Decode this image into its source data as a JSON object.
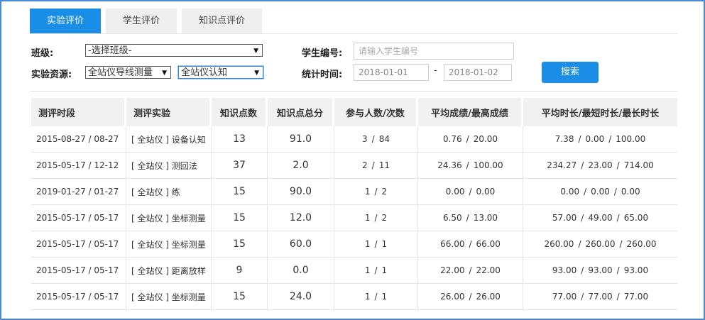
{
  "tabs": [
    {
      "label": "实验评价",
      "active": true
    },
    {
      "label": "学生评价",
      "active": false
    },
    {
      "label": "知识点评价",
      "active": false
    }
  ],
  "filters": {
    "class_label": "班级:",
    "class_value": "-选择班级-",
    "resource_label": "实验资源:",
    "resource_value_1": "全站仪导线测量",
    "resource_value_2": "全站仪认知",
    "student_label": "学生编号:",
    "student_placeholder": "请输入学生编号",
    "time_label": "统计时间:",
    "date_from": "2018-01-01",
    "date_to": "2018-01-02",
    "date_separator": "-",
    "search_label": "搜索"
  },
  "table": {
    "headers": [
      "测评时段",
      "测评实验",
      "知识点数",
      "知识点总分",
      "参与人数/次数",
      "平均成绩/最高成绩",
      "平均时长/最短时长/最长时长"
    ],
    "rows": [
      {
        "period": "2015-08-27 / 08-27",
        "experiment": "[ 全站仪 ] 设备认知",
        "kp_count": "13",
        "kp_total": "91.0",
        "participants": "3",
        "attempts": "84",
        "avg_score": "0.76",
        "max_score": "20.00",
        "avg_time": "7.38",
        "min_time": "0.00",
        "max_time": "100.00"
      },
      {
        "period": "2015-05-17 / 12-12",
        "experiment": "[ 全站仪 ] 测回法",
        "kp_count": "37",
        "kp_total": "2.0",
        "participants": "2",
        "attempts": "11",
        "avg_score": "24.36",
        "max_score": "100.00",
        "avg_time": "234.27",
        "min_time": "23.00",
        "max_time": "714.00"
      },
      {
        "period": "2019-01-27 / 01-27",
        "experiment": "[ 全站仪 ] 练",
        "kp_count": "15",
        "kp_total": "90.0",
        "participants": "1",
        "attempts": "2",
        "avg_score": "0.00",
        "max_score": "0.00",
        "avg_time": "0.00",
        "min_time": "0.00",
        "max_time": "0.00"
      },
      {
        "period": "2015-05-17 / 05-17",
        "experiment": "[ 全站仪 ] 坐标测量",
        "kp_count": "15",
        "kp_total": "12.0",
        "participants": "1",
        "attempts": "2",
        "avg_score": "6.50",
        "max_score": "13.00",
        "avg_time": "57.00",
        "min_time": "49.00",
        "max_time": "65.00"
      },
      {
        "period": "2015-05-17 / 05-17",
        "experiment": "[ 全站仪 ] 坐标测量",
        "kp_count": "15",
        "kp_total": "60.0",
        "participants": "1",
        "attempts": "1",
        "avg_score": "66.00",
        "max_score": "66.00",
        "avg_time": "260.00",
        "min_time": "260.00",
        "max_time": "260.00"
      },
      {
        "period": "2015-05-17 / 05-17",
        "experiment": "[ 全站仪 ] 距离放样",
        "kp_count": "9",
        "kp_total": "0.0",
        "participants": "1",
        "attempts": "1",
        "avg_score": "22.00",
        "max_score": "22.00",
        "avg_time": "93.00",
        "min_time": "93.00",
        "max_time": "93.00"
      },
      {
        "period": "2015-05-17 / 05-17",
        "experiment": "[ 全站仪 ] 坐标测量",
        "kp_count": "15",
        "kp_total": "24.0",
        "participants": "1",
        "attempts": "1",
        "avg_score": "26.00",
        "max_score": "26.00",
        "avg_time": "77.00",
        "min_time": "77.00",
        "max_time": "77.00"
      }
    ]
  },
  "colors": {
    "accent": "#1a8ee6",
    "frame": "#4d8ad6",
    "header_bg": "#f1f1f1"
  },
  "icons": {
    "select_arrow": "dropdown-arrow-icon"
  }
}
